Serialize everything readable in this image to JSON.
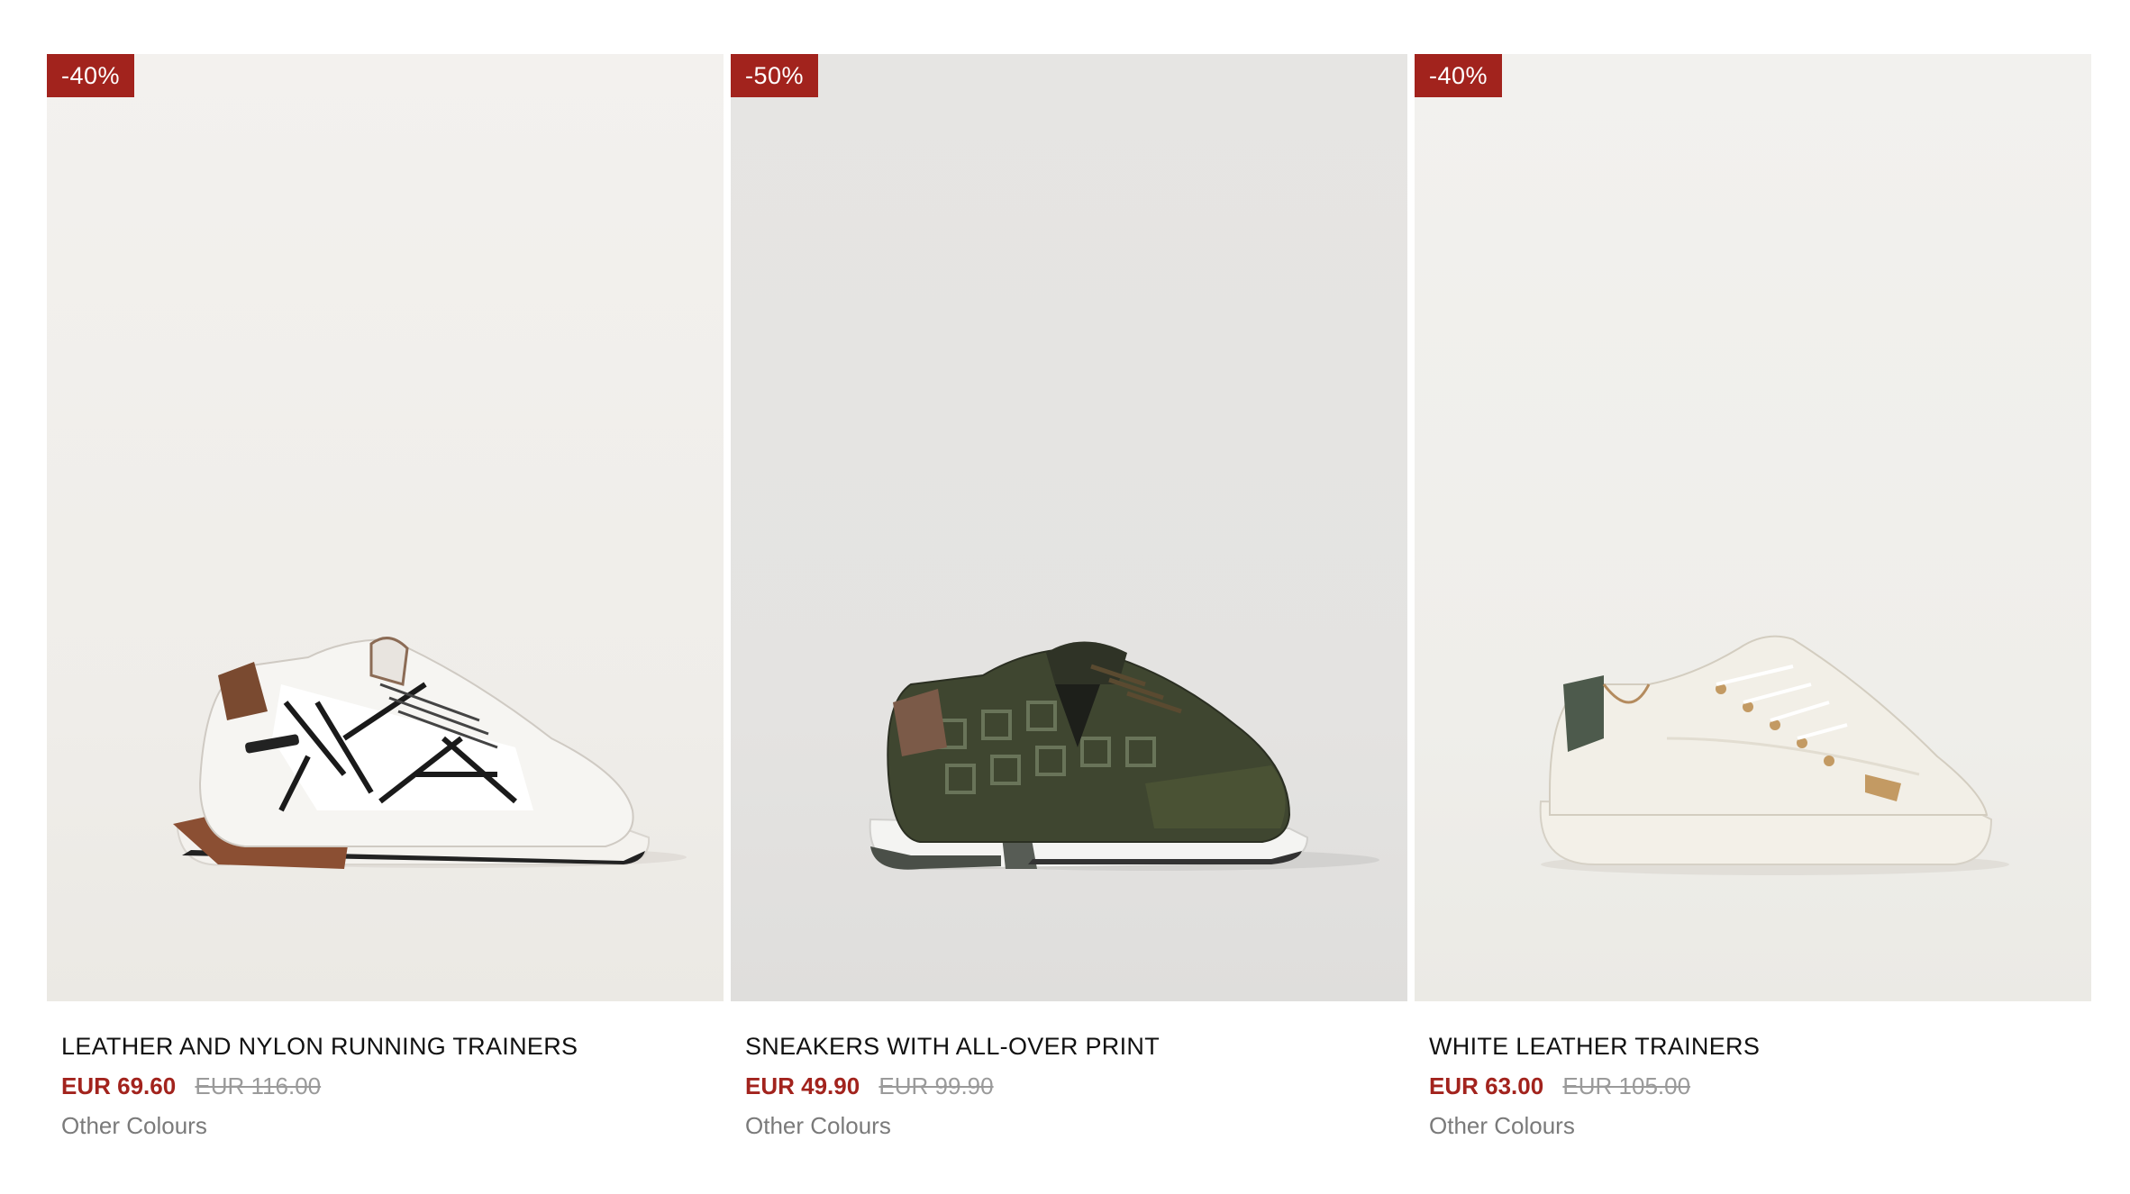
{
  "products": [
    {
      "badge": "-40%",
      "name": "LEATHER AND NYLON RUNNING TRAINERS",
      "price": "EUR 69.60",
      "old_price": "EUR 116.00",
      "colours_link": "Other Colours",
      "image_icon": "running-trainer-white-brown-icon"
    },
    {
      "badge": "-50%",
      "name": "SNEAKERS WITH ALL-OVER PRINT",
      "price": "EUR 49.90",
      "old_price": "EUR 99.90",
      "colours_link": "Other Colours",
      "image_icon": "sneaker-olive-print-icon"
    },
    {
      "badge": "-40%",
      "name": "WHITE LEATHER TRAINERS",
      "price": "EUR 63.00",
      "old_price": "EUR 105.00",
      "colours_link": "Other Colours",
      "image_icon": "trainer-white-leather-icon"
    }
  ],
  "colors": {
    "sale_red": "#a2231d",
    "old_price_gray": "#9a9a9a"
  }
}
